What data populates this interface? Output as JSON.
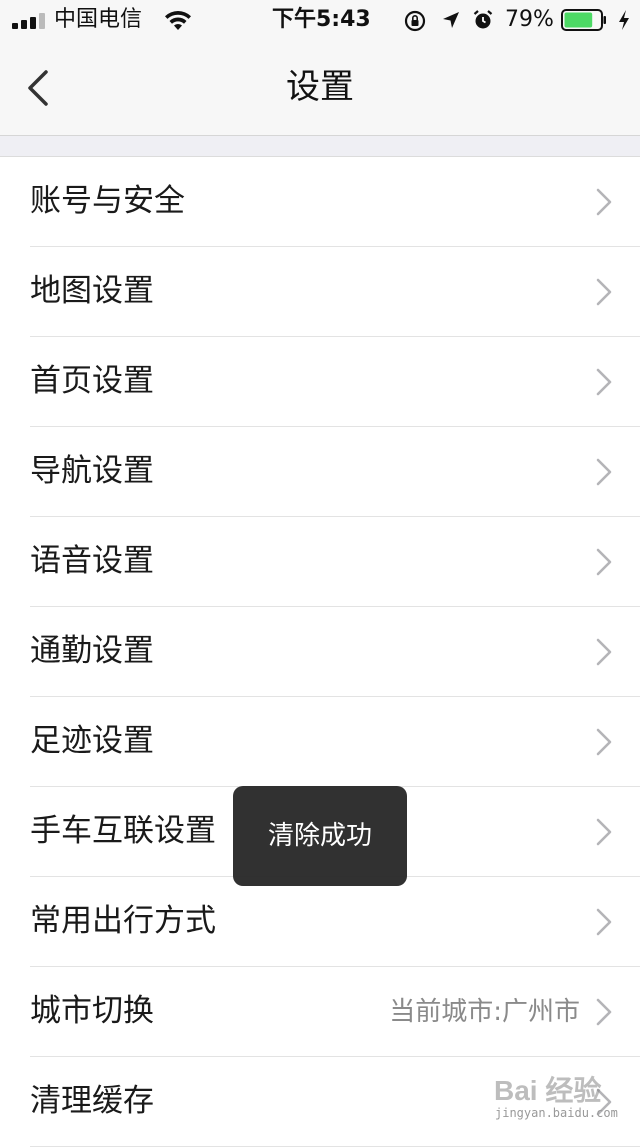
{
  "status_bar": {
    "carrier": "中国电信",
    "time": "下午5:43",
    "battery_percent": "79%",
    "battery_level": 0.79
  },
  "nav": {
    "title": "设置"
  },
  "settings": {
    "items": [
      {
        "label": "账号与安全",
        "value": ""
      },
      {
        "label": "地图设置",
        "value": ""
      },
      {
        "label": "首页设置",
        "value": ""
      },
      {
        "label": "导航设置",
        "value": ""
      },
      {
        "label": "语音设置",
        "value": ""
      },
      {
        "label": "通勤设置",
        "value": ""
      },
      {
        "label": "足迹设置",
        "value": ""
      },
      {
        "label": "手车互联设置",
        "value": ""
      },
      {
        "label": "常用出行方式",
        "value": ""
      },
      {
        "label": "城市切换",
        "value": "当前城市:广州市"
      },
      {
        "label": "清理缓存",
        "value": ""
      }
    ]
  },
  "toast": {
    "message": "清除成功"
  },
  "watermark": {
    "text": "Bai 经验",
    "sub": "jingyan.baidu.com"
  },
  "colors": {
    "battery_green": "#4cd964",
    "toast_bg": "#262626",
    "chevron": "#c7c7cc"
  }
}
